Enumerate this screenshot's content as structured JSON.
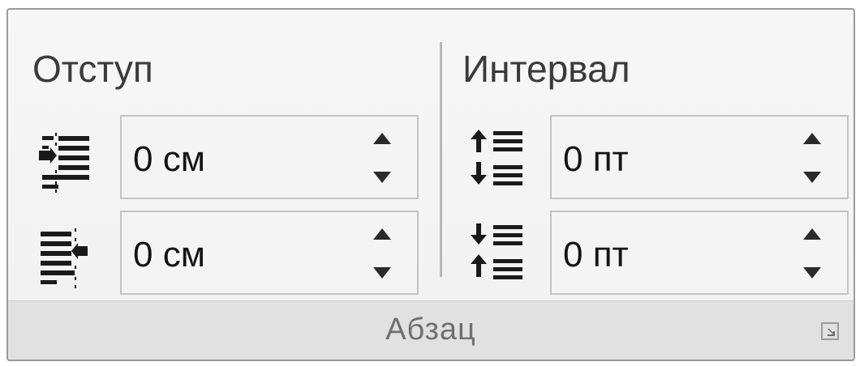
{
  "indent": {
    "heading": "Отступ",
    "left": {
      "value": "0 см",
      "icon": "indent-left-icon"
    },
    "right": {
      "value": "0 см",
      "icon": "indent-right-icon"
    }
  },
  "spacing": {
    "heading": "Интервал",
    "before": {
      "value": "0 пт",
      "icon": "spacing-before-icon"
    },
    "after": {
      "value": "0 пт",
      "icon": "spacing-after-icon"
    }
  },
  "group": {
    "label": "Абзац",
    "launcher_icon": "dialog-launcher-icon"
  }
}
